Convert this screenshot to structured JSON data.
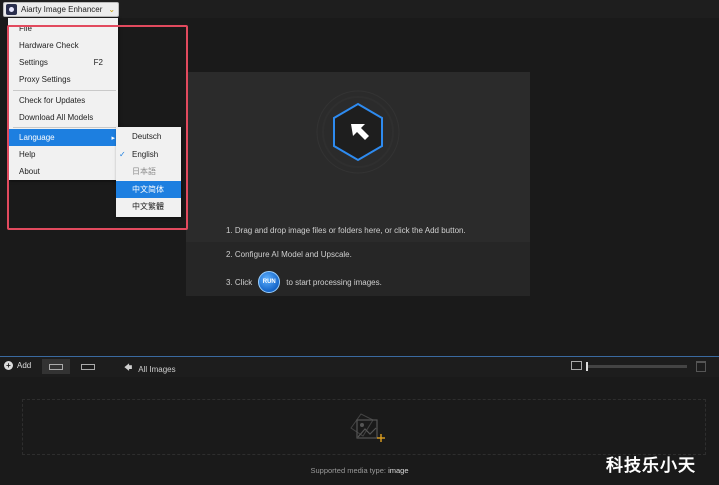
{
  "app": {
    "title": "Aiarty Image Enhancer"
  },
  "menu": {
    "items": [
      {
        "label": "File"
      },
      {
        "label": "Hardware Check"
      },
      {
        "label": "Settings",
        "shortcut": "F2"
      },
      {
        "label": "Proxy Settings"
      },
      {
        "label": "Check for Updates"
      },
      {
        "label": "Download All Models"
      },
      {
        "label": "Language"
      },
      {
        "label": "Help"
      },
      {
        "label": "About"
      }
    ]
  },
  "language_menu": {
    "items": [
      {
        "label": "Deutsch"
      },
      {
        "label": "English",
        "checked": true
      },
      {
        "label": "日本語",
        "disabled": true
      },
      {
        "label": "中文简体",
        "highlighted": true
      },
      {
        "label": "中文繁體"
      }
    ],
    "check_mark": "✓"
  },
  "drop_panel": {
    "step1": "1. Drag and drop image files or folders here, or click the Add button.",
    "step2": "2. Configure AI Model and Upscale.",
    "step3_prefix": "3. Click",
    "run_label": "RUN",
    "step3_suffix": "to start processing images."
  },
  "toolbar": {
    "add_label": "Add",
    "all_images_label": "All Images"
  },
  "media": {
    "supported_prefix": "Supported media type:",
    "supported_value": "image"
  },
  "watermark": "科技乐小天",
  "colors": {
    "accent": "#1d7fe0",
    "highlight_border": "#e24a5e",
    "add_plus": "#e0a020"
  },
  "icons": {
    "app": "app-logo-icon",
    "dropdown": "chevron-down-icon",
    "upload": "upload-arrow-icon",
    "add": "plus-circle-icon",
    "back": "arrow-left-icon",
    "grid": "grid-view-icon",
    "list": "list-view-icon",
    "thumbnail": "image-icon",
    "trash": "trash-icon",
    "add_media": "add-image-icon"
  }
}
